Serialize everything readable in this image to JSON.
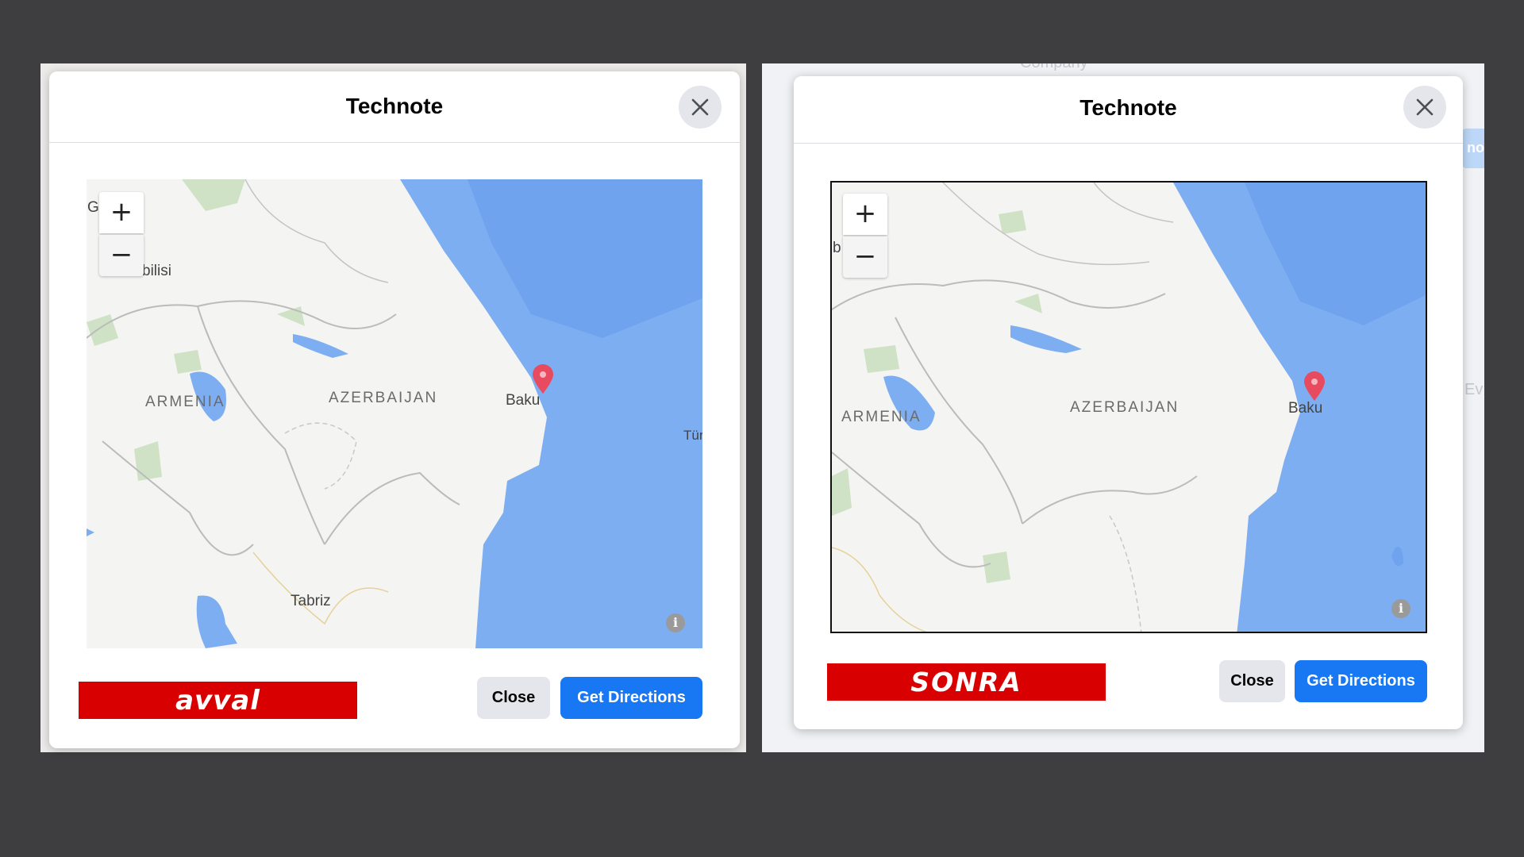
{
  "left": {
    "title": "Technote",
    "banner": "avval",
    "close_label": "Close",
    "directions_label": "Get Directions",
    "map": {
      "labels": {
        "tbilisi": "bilisi",
        "cutoff_top": "Gl",
        "armenia": "ARMENIA",
        "azerbaijan": "AZERBAIJAN",
        "baku": "Baku",
        "tabriz": "Tabriz",
        "turk": "Tür"
      },
      "zoom_in": "+",
      "zoom_out": "−",
      "info": "i"
    }
  },
  "right": {
    "title": "Technote",
    "banner": "SONRA",
    "close_label": "Close",
    "directions_label": "Get Directions",
    "background": {
      "company": "Company",
      "btn_fragment": "no",
      "ev": "Ev"
    },
    "map": {
      "labels": {
        "cutoff_left": "b",
        "armenia": "ARMENIA",
        "azerbaijan": "AZERBAIJAN",
        "baku": "Baku"
      },
      "zoom_in": "+",
      "zoom_out": "−",
      "info": "i"
    }
  },
  "colors": {
    "accent": "#1877f2",
    "banner_red": "#d80000",
    "water": "#7eaef2",
    "pin": "#e84a5f"
  },
  "icons": [
    "close-icon",
    "zoom-in-icon",
    "zoom-out-icon",
    "map-pin-icon",
    "info-icon"
  ]
}
